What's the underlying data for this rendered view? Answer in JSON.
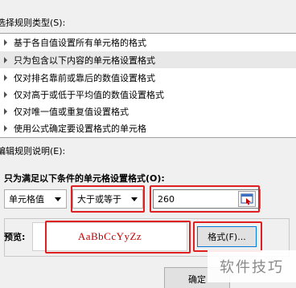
{
  "rule_type_section": {
    "label": "选择规则类型(S):",
    "items": [
      {
        "label": "基于各自值设置所有单元格的格式",
        "selected": false
      },
      {
        "label": "只为包含以下内容的单元格设置格式",
        "selected": true
      },
      {
        "label": "仅对排名靠前或靠后的数值设置格式",
        "selected": false
      },
      {
        "label": "仅对高于或低于平均值的数值设置格式",
        "selected": false
      },
      {
        "label": "仅对唯一值或重复值设置格式",
        "selected": false
      },
      {
        "label": "使用公式确定要设置格式的单元格",
        "selected": false
      }
    ]
  },
  "rule_description_section": {
    "label": "编辑规则说明(E):",
    "condition_title": "只为满足以下条件的单元格设置格式(O):",
    "field_select": "单元格值",
    "operator_select": "大于或等于",
    "value_input": "260",
    "preview_label": "预览:",
    "preview_sample": "AaBbCcYyZz",
    "format_button": "格式(F)...",
    "ok_button": "确定"
  },
  "watermark": "软件技巧",
  "colors": {
    "highlight": "#e02020",
    "preview_text": "#c00000",
    "selected_row": "#e8e8e8"
  }
}
